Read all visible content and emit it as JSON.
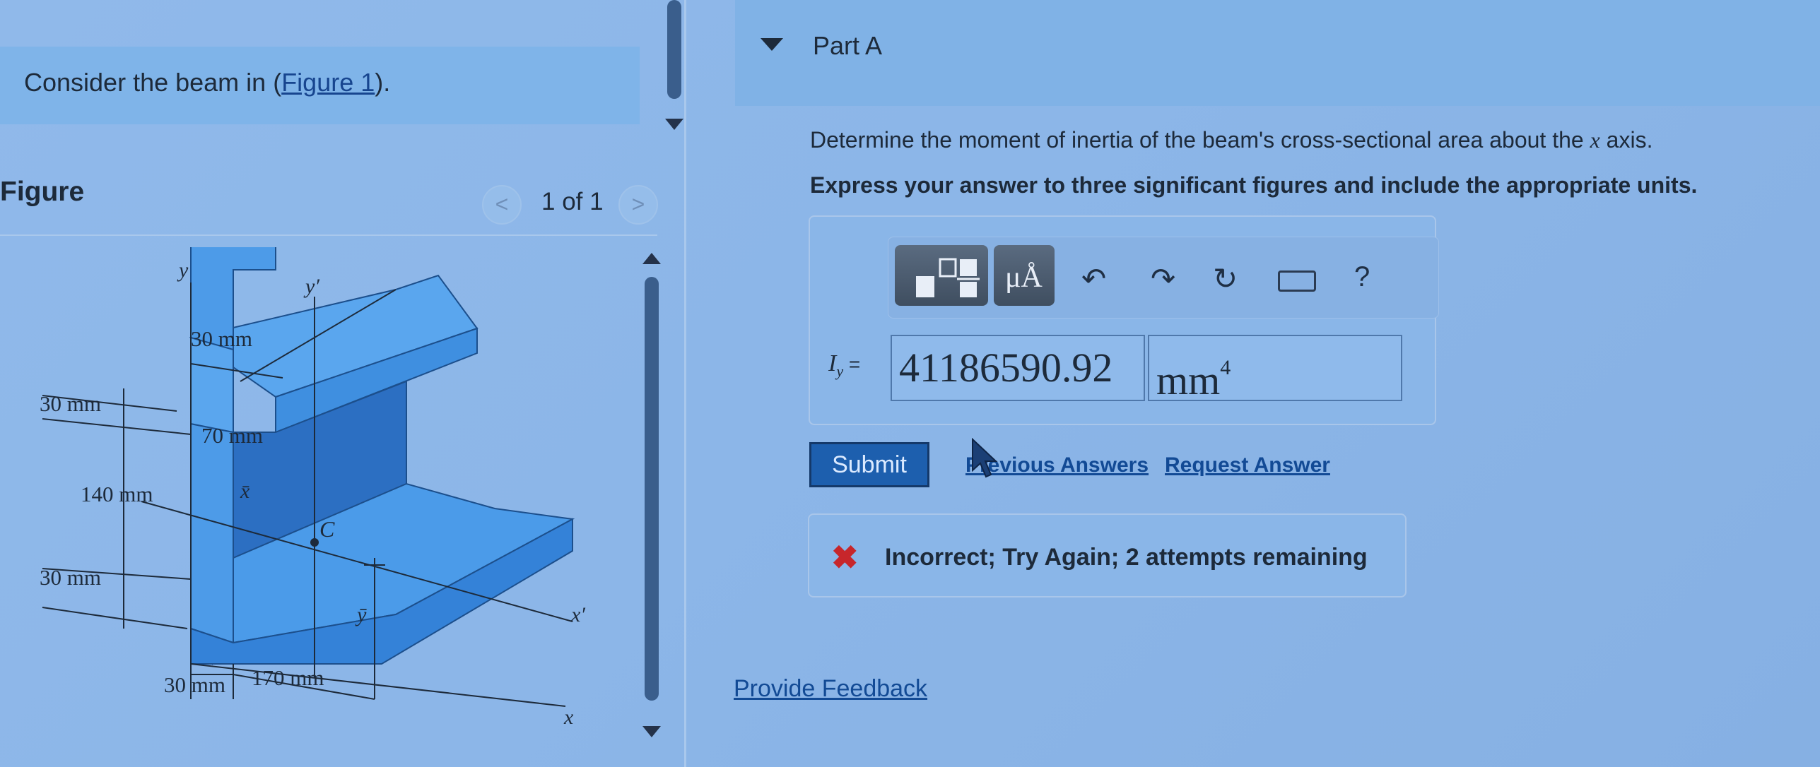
{
  "intro": {
    "text_before": "Consider the beam in (",
    "link": "Figure 1",
    "text_after": ")."
  },
  "figure": {
    "title": "Figure",
    "pager": "1 of 1",
    "prev_glyph": "<",
    "next_glyph": ">",
    "labels": {
      "y": "y",
      "y_prime": "y′",
      "dim_30_top": "30 mm",
      "dim_30_left": "30 mm",
      "dim_70": "70 mm",
      "dim_140": "140 mm",
      "dim_30_lower": "30 mm",
      "dim_30_bottom": "30 mm",
      "dim_170": "170 mm",
      "x_bar": "x̄",
      "centroid": "C",
      "y_bar": "ȳ",
      "x_prime": "x′",
      "x": "x"
    }
  },
  "part": {
    "title": "Part A",
    "question_before": "Determine the moment of inertia of the beam's cross-sectional area about the ",
    "question_var": "x",
    "question_after": " axis.",
    "instruction": "Express your answer to three significant figures and include the appropriate units."
  },
  "toolbar": {
    "units_glyph": "μÅ",
    "undo_icon": "undo-icon",
    "redo_icon": "redo-icon",
    "reset_icon": "reset-icon",
    "keyboard_icon": "keyboard-icon",
    "help": "?"
  },
  "answer": {
    "label_var": "I",
    "label_sub": "y",
    "label_eq": " = ",
    "value": "41186590.92",
    "units": "mm",
    "units_exp": "4"
  },
  "actions": {
    "submit": "Submit",
    "previous_answers": "Previous Answers",
    "request_answer": "Request Answer"
  },
  "feedback": {
    "icon": "✖",
    "message": "Incorrect; Try Again; 2 attempts remaining"
  },
  "footer": {
    "provide_feedback": "Provide Feedback"
  },
  "colors": {
    "background": "#8cb6e8",
    "beam_face": "#3f8fe0",
    "beam_dark": "#2c6fc2",
    "error": "#c7262b",
    "link": "#124a95",
    "submit": "#1d5fae"
  }
}
